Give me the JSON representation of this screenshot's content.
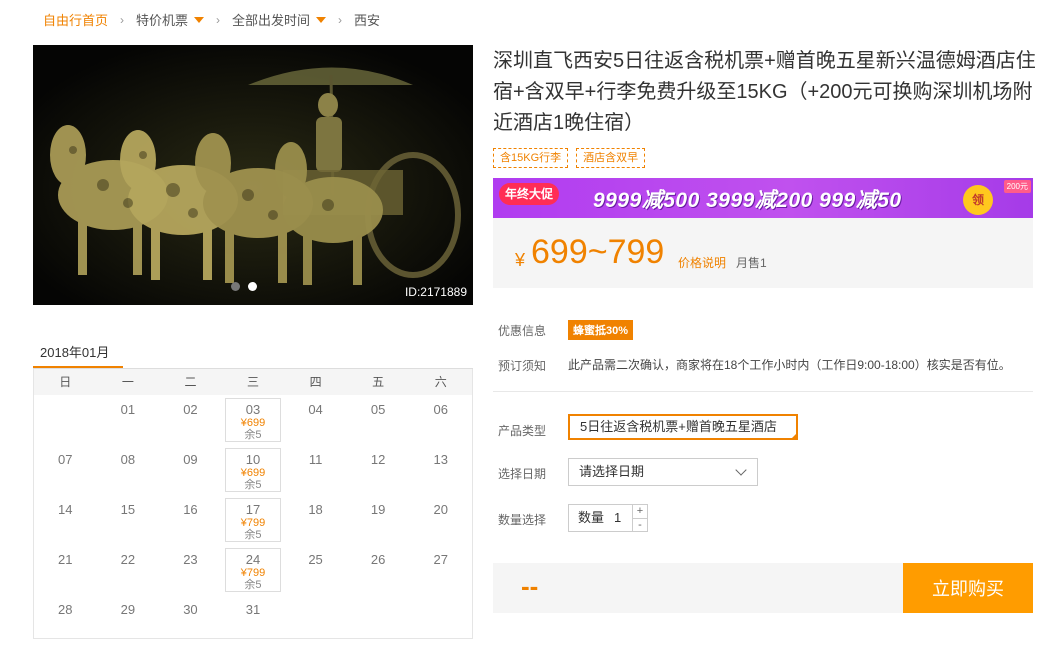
{
  "breadcrumb": {
    "home": "自由行首页",
    "items": [
      "特价机票",
      "全部出发时间",
      "西安"
    ]
  },
  "photo": {
    "id_label": "ID:2171889",
    "slides": 2,
    "active_slide": 2
  },
  "calendar": {
    "month": "2018年01月",
    "weekdays": [
      "日",
      "一",
      "二",
      "三",
      "四",
      "五",
      "六"
    ],
    "leading_blanks": 1,
    "days": [
      {
        "d": "01"
      },
      {
        "d": "02"
      },
      {
        "d": "03",
        "price": "¥699",
        "stock": "余5"
      },
      {
        "d": "04"
      },
      {
        "d": "05"
      },
      {
        "d": "06"
      },
      {
        "d": "07"
      },
      {
        "d": "08"
      },
      {
        "d": "09"
      },
      {
        "d": "10",
        "price": "¥699",
        "stock": "余5"
      },
      {
        "d": "11"
      },
      {
        "d": "12"
      },
      {
        "d": "13"
      },
      {
        "d": "14"
      },
      {
        "d": "15"
      },
      {
        "d": "16"
      },
      {
        "d": "17",
        "price": "¥799",
        "stock": "余5"
      },
      {
        "d": "18"
      },
      {
        "d": "19"
      },
      {
        "d": "20"
      },
      {
        "d": "21"
      },
      {
        "d": "22"
      },
      {
        "d": "23"
      },
      {
        "d": "24",
        "price": "¥799",
        "stock": "余5"
      },
      {
        "d": "25"
      },
      {
        "d": "26"
      },
      {
        "d": "27"
      },
      {
        "d": "28"
      },
      {
        "d": "29"
      },
      {
        "d": "30"
      },
      {
        "d": "31"
      }
    ]
  },
  "product": {
    "title": "深圳直飞西安5日往返含税机票+赠首晚五星新兴温德姆酒店住宿+含双早+行李免费升级至15KG（+200元可换购深圳机场附近酒店1晚住宿）",
    "tags": [
      "含15KG行李",
      "酒店含双早"
    ]
  },
  "banner": {
    "badge": "年终大促",
    "text": "9999减500  3999减200  999减50",
    "coupon": "领",
    "corner_tag": "200元"
  },
  "price": {
    "currency": "¥",
    "range": "699~799",
    "explain_link": "价格说明",
    "sold": "月售1"
  },
  "info": {
    "promo_label": "优惠信息",
    "promo_badge": "蜂蜜抵30%",
    "notice_label": "预订须知",
    "notice_text": "此产品需二次确认，商家将在18个工作小时内（工作日9:00-18:00）核实是否有位。"
  },
  "form": {
    "type_label": "产品类型",
    "type_value": "5日往返含税机票+赠首晚五星酒店",
    "date_label": "选择日期",
    "date_value": "请选择日期",
    "qty_label": "数量选择",
    "qty_prefix": "数量",
    "qty_value": "1",
    "plus": "+",
    "minus": "-"
  },
  "buy": {
    "total": "--",
    "button": "立即购买"
  },
  "colors": {
    "accent": "#f08200",
    "buy_button": "#ff9c00",
    "banner": "#c051ee"
  }
}
